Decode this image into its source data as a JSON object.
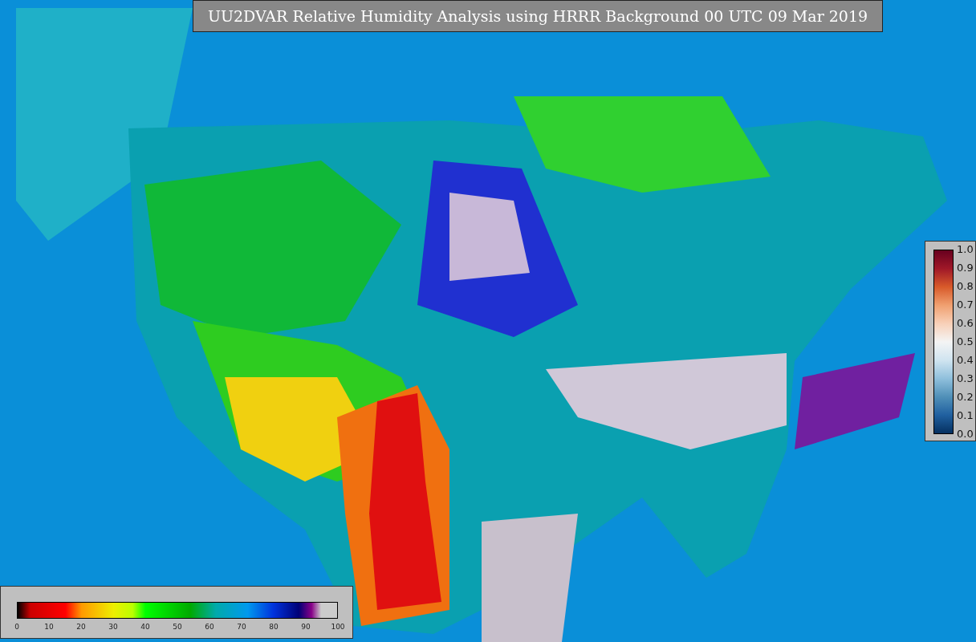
{
  "title": "UU2DVAR Relative Humidity Analysis using HRRR Background 00 UTC 09 Mar 2019",
  "humidity_legend": {
    "ticks": [
      "0",
      "10",
      "20",
      "30",
      "40",
      "50",
      "60",
      "70",
      "80",
      "90",
      "100"
    ]
  },
  "observation_legend": {
    "ticks": [
      "1.0",
      "0.9",
      "0.8",
      "0.7",
      "0.6",
      "0.5",
      "0.4",
      "0.3",
      "0.2",
      "0.1",
      "0.0"
    ]
  }
}
